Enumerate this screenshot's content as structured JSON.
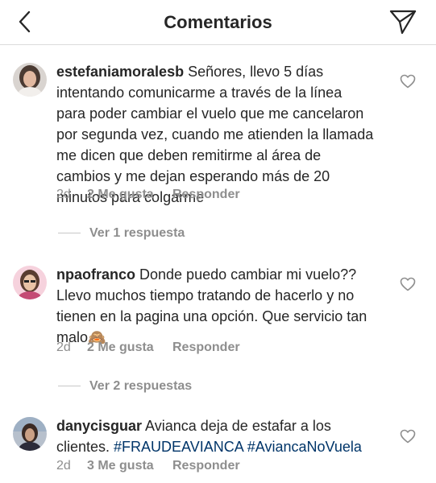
{
  "header": {
    "title": "Comentarios",
    "back_icon": "chevron-left-icon",
    "send_icon": "paper-plane-icon"
  },
  "comments": [
    {
      "username": "estefaniamoralesb",
      "text": " Señores, llevo 5 días intentando comunicarme a través de la línea para poder cambiar el vuelo que me cancelaron por segunda vez, cuando me atienden la llamada me dicen que deben remitirme al área de cambios y me dejan esperando más de 20 minutos para colgarme",
      "time": "2d",
      "likes": "2 Me gusta",
      "reply": "Responder",
      "view_replies": "Ver 1 respuesta"
    },
    {
      "username": "npaofranco",
      "text": " Donde puedo cambiar mi vuelo?? Llevo muchos tiempo tratando de hacerlo y no tienen en la pagina una opción. Que servicio tan malo🙈",
      "time": "2d",
      "likes": "2 Me gusta",
      "reply": "Responder",
      "view_replies": "Ver 2 respuestas"
    },
    {
      "username": "danycisguar",
      "text": " Avianca deja de estafar a los clientes. ",
      "hashtag1": "#FRAUDEAVIANCA",
      "hashtag2": "#AviancaNoVuela",
      "time": "2d",
      "likes": "3 Me gusta",
      "reply": "Responder"
    }
  ],
  "colors": {
    "text": "#262626",
    "muted": "#8e8e8e",
    "hashtag": "#003569",
    "divider": "#dbdbdb"
  }
}
